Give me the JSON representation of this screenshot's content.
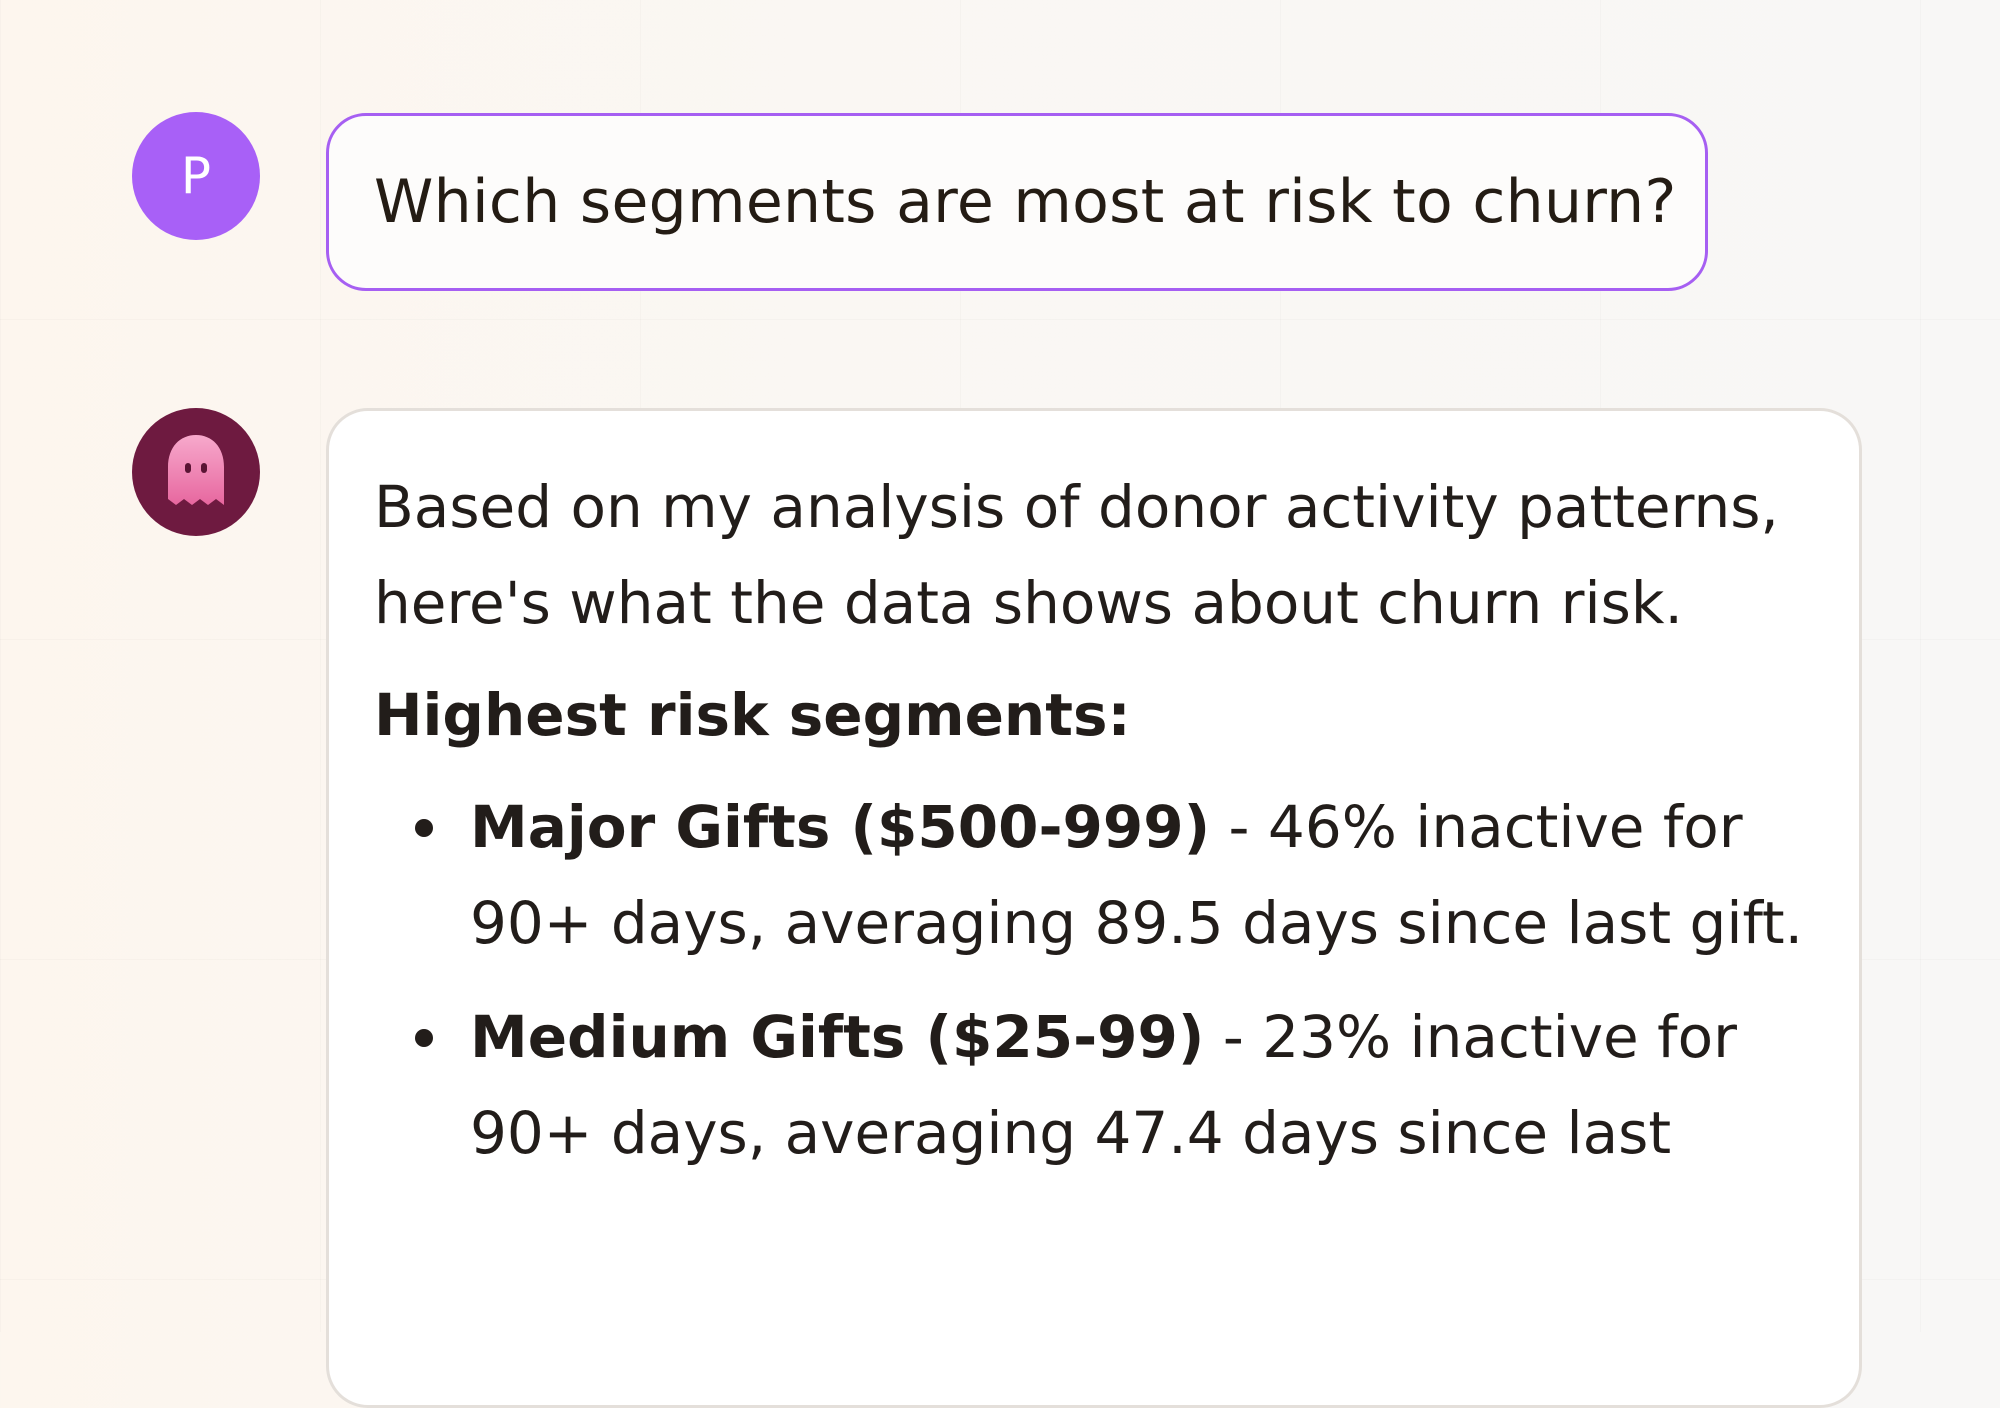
{
  "user": {
    "avatar_letter": "P",
    "message": "Which segments are most at risk to churn?",
    "colors": {
      "avatar": "#a860f7",
      "bubble_border": "#a65ff2"
    }
  },
  "assistant": {
    "avatar_icon": "ghost-icon",
    "colors": {
      "avatar": "#6e1a40",
      "ghost": "#f08cbc"
    },
    "intro": "Based on my analysis of donor activity patterns, here's what the data shows about churn risk.",
    "heading": "Highest risk segments:",
    "segments": [
      {
        "name": "Major Gifts ($500-999)",
        "detail": " - 46% inactive for 90+ days, averaging 89.5 days since last gift."
      },
      {
        "name": "Medium Gifts ($25-99)",
        "detail": " - 23% inactive for 90+ days, averaging 47.4 days since last"
      }
    ]
  }
}
